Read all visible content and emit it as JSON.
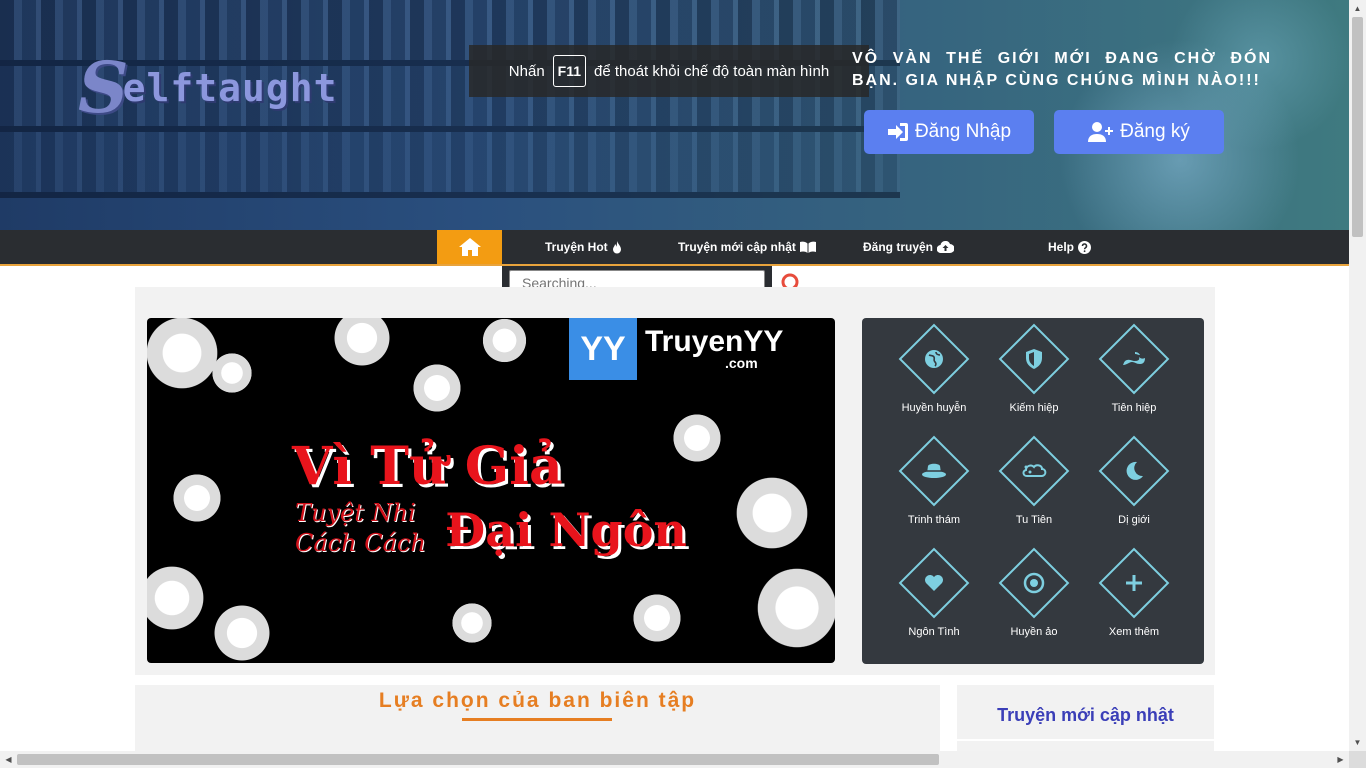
{
  "header": {
    "logo_initial": "S",
    "logo_text": "elftaught",
    "fullscreen_notice": {
      "prefix": "Nhấn",
      "key": "F11",
      "suffix": "để thoát khỏi chế độ toàn màn hình"
    },
    "slogan": "VÔ VÀN THẾ GIỚI MỚI ĐANG CHỜ ĐÓN BẠN. GIA NHẬP CÙNG CHÚNG MÌNH NÀO!!!",
    "login_label": "Đăng Nhập",
    "register_label": "Đăng ký"
  },
  "nav": {
    "items": [
      {
        "label": "Truyện Hot",
        "icon": "fire-icon"
      },
      {
        "label": "Truyện mới cập nhật",
        "icon": "book-open-icon"
      },
      {
        "label": "Đăng truyện",
        "icon": "cloud-upload-icon"
      },
      {
        "label": "Help",
        "icon": "question-circle-icon"
      }
    ]
  },
  "search": {
    "placeholder": "Searching..."
  },
  "banner": {
    "site_badge": "YY",
    "site_name": "TruyenYY",
    "site_domain": ".com",
    "title_line1": "Vì Tử Giả",
    "title_line2": "Đại Ngôn",
    "subtitle": "Tuyệt Nhi Cách Cách"
  },
  "genres": [
    {
      "label": "Huyền huyễn",
      "icon": "globe-icon"
    },
    {
      "label": "Kiếm hiệp",
      "icon": "shield-icon"
    },
    {
      "label": "Tiên hiệp",
      "icon": "dragon-icon"
    },
    {
      "label": "Trinh thám",
      "icon": "detective-hat-icon"
    },
    {
      "label": "Tu Tiên",
      "icon": "cloud-swirl-icon"
    },
    {
      "label": "Dị giới",
      "icon": "moon-icon"
    },
    {
      "label": "Ngôn Tình",
      "icon": "heart-icon"
    },
    {
      "label": "Huyền ảo",
      "icon": "target-icon"
    },
    {
      "label": "Xem thêm",
      "icon": "plus-icon"
    }
  ],
  "sections": {
    "editor_choice": "Lựa chọn của ban biên tập",
    "new_updates": "Truyện mới cập nhật"
  },
  "colors": {
    "nav_bg": "#2a2d31",
    "nav_home": "#f39c12",
    "auth_button": "#5b7ff0",
    "genre_outline": "#7ecfe0",
    "editor_title": "#e67e22",
    "updates_title": "#3b3fb8"
  }
}
